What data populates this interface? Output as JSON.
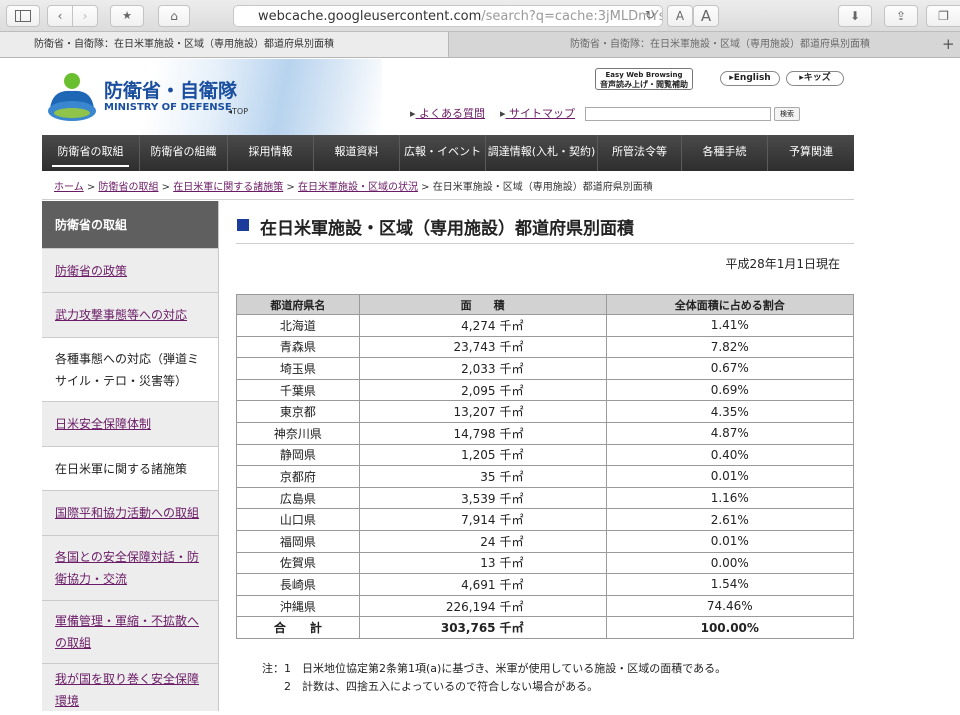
{
  "browser": {
    "url_main": "webcache.googleusercontent.com",
    "url_rest": "/search?q=cache:3jMLDmYsEpl",
    "font_small_label": "A",
    "font_large_label": "A",
    "tabs": [
      "防衛省・自衛隊：在日米軍施設・区域（専用施設）都道府県別面積",
      "防衛省・自衛隊：在日米軍施設・区域（専用施設）都道府県別面積"
    ]
  },
  "header": {
    "logo_ja": "防衛省・自衛隊",
    "logo_en": "MINISTRY OF DEFENSE",
    "logo_top": "◂TOP",
    "ewb_line1": "Easy Web Browsing",
    "ewb_line2": "音声読み上げ・閲覧補助",
    "english": "▸English",
    "kids": "▸キッズ",
    "faq": "よくある質問",
    "sitemap": "サイトマップ",
    "search_button": "検索",
    "search_placeholder": ""
  },
  "gnav": [
    "防衛省の取組",
    "防衛省の組織",
    "採用情報",
    "報道資料",
    "広報・イベント",
    "調達情報(入札・契約)",
    "所管法令等",
    "各種手続",
    "予算関連"
  ],
  "breadcrumb": {
    "items": [
      "ホーム",
      "防衛省の取組",
      "在日米軍に関する諸施策",
      "在日米軍施設・区域の状況"
    ],
    "current": "在日米軍施設・区域（専用施設）都道府県別面積"
  },
  "sidebar": {
    "title": "防衛省の取組",
    "items": [
      "防衛省の政策",
      "武力攻撃事態等への対応",
      "各種事態への対応（弾道ミサイル・テロ・災害等）",
      "日米安全保障体制",
      "在日米軍に関する諸施策",
      "国際平和協力活動への取組",
      "各国との安全保障対話・防衛協力・交流",
      "軍備管理・軍縮・不拡散への取組",
      "我が国を取り巻く安全保障環境"
    ]
  },
  "main": {
    "title": "在日米軍施設・区域（専用施設）都道府県別面積",
    "as_of": "平成28年1月1日現在",
    "table": {
      "headers": [
        "都道府県名",
        "面　　積",
        "全体面積に占める割合"
      ],
      "unit": "千㎡",
      "rows": [
        [
          "北海道",
          "4,274",
          "1.41%"
        ],
        [
          "青森県",
          "23,743",
          "7.82%"
        ],
        [
          "埼玉県",
          "2,033",
          "0.67%"
        ],
        [
          "千葉県",
          "2,095",
          "0.69%"
        ],
        [
          "東京都",
          "13,207",
          "4.35%"
        ],
        [
          "神奈川県",
          "14,798",
          "4.87%"
        ],
        [
          "静岡県",
          "1,205",
          "0.40%"
        ],
        [
          "京都府",
          "35",
          "0.01%"
        ],
        [
          "広島県",
          "3,539",
          "1.16%"
        ],
        [
          "山口県",
          "7,914",
          "2.61%"
        ],
        [
          "福岡県",
          "24",
          "0.01%"
        ],
        [
          "佐賀県",
          "13",
          "0.00%"
        ],
        [
          "長崎県",
          "4,691",
          "1.54%"
        ],
        [
          "沖縄県",
          "226,194",
          "74.46%"
        ]
      ],
      "total": [
        "合　　計",
        "303,765",
        "100.00%"
      ]
    },
    "notes": [
      "注：1　日米地位協定第2条第1項(a)に基づき、米軍が使用している施設・区域の面積である。",
      "　　2　計数は、四捨五入によっているので符合しない場合がある。"
    ]
  }
}
